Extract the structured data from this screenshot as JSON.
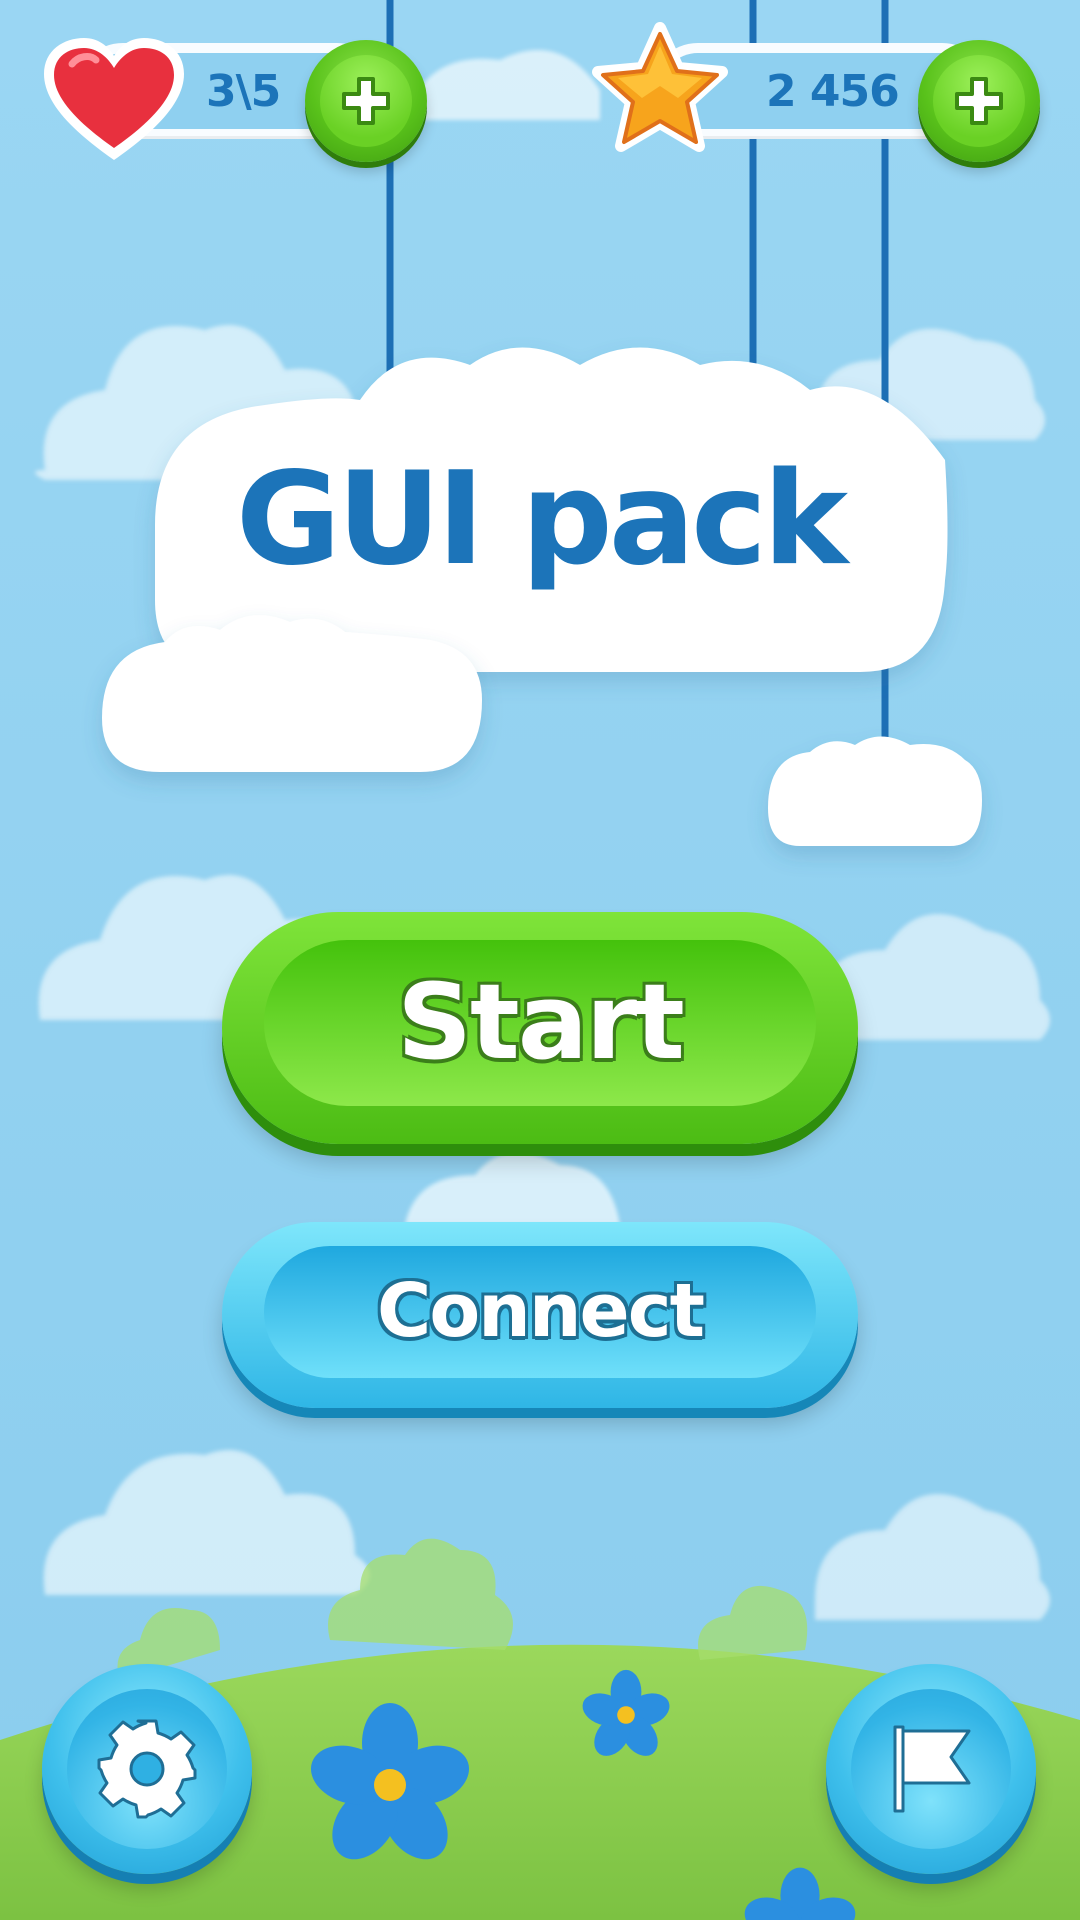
{
  "hud": {
    "lives": {
      "icon": "heart-icon",
      "value": "3\\5",
      "add_icon": "plus-icon"
    },
    "stars": {
      "icon": "star-icon",
      "value": "2 456",
      "add_icon": "plus-icon"
    }
  },
  "title": "GUI pack",
  "menu": {
    "start_label": "Start",
    "connect_label": "Connect"
  },
  "footer": {
    "settings_icon": "gear-icon",
    "flag_icon": "flag-icon"
  },
  "colors": {
    "sky": "#8fd0f0",
    "title_text": "#1c74b9",
    "start_button": "#59c21b",
    "connect_button": "#2fb6e6",
    "grass": "#8ccf4f",
    "heart": "#e8303e",
    "star": "#f7a41c"
  }
}
